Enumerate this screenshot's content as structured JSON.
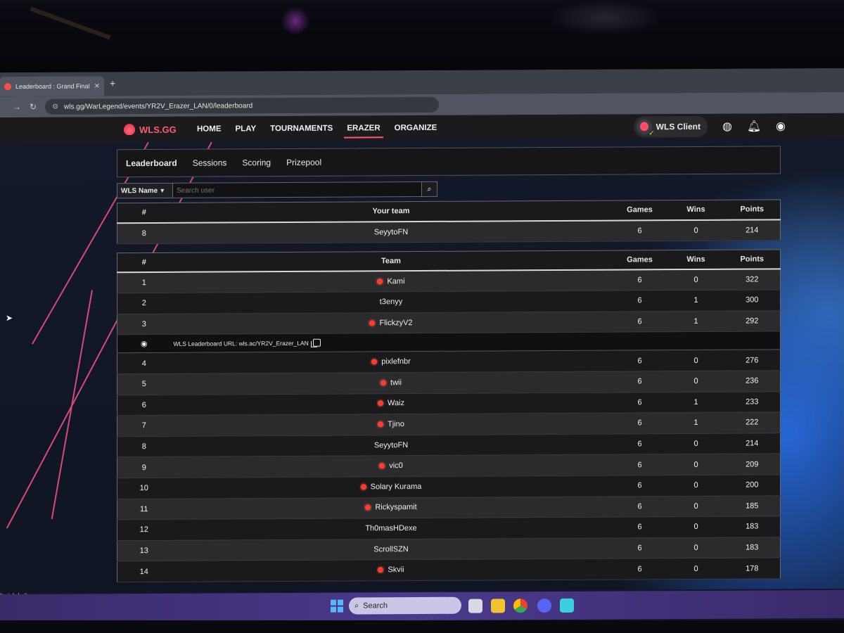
{
  "browser": {
    "tab_title": "Leaderboard : Grand Final | Era:",
    "tab_close": "✕",
    "new_tab": "+",
    "url": "wls.gg/WarLegend/events/YR2V_Erazer_LAN/0/leaderboard"
  },
  "site": {
    "logo": "WLS.GG",
    "nav": [
      "HOME",
      "PLAY",
      "TOURNAMENTS",
      "ERAZER",
      "ORGANIZE"
    ],
    "active_nav": "ERAZER",
    "client_label": "WLS Client"
  },
  "subtabs": [
    "Leaderboard",
    "Sessions",
    "Scoring",
    "Prizepool"
  ],
  "search": {
    "filter": "WLS Name",
    "placeholder": "Search user"
  },
  "your_team": {
    "headers": {
      "rank": "#",
      "team": "Your team",
      "games": "Games",
      "wins": "Wins",
      "points": "Points"
    },
    "row": {
      "rank": "8",
      "team": "SeyytoFN",
      "games": "6",
      "wins": "0",
      "points": "214"
    }
  },
  "leaderboard": {
    "headers": {
      "rank": "#",
      "team": "Team",
      "games": "Games",
      "wins": "Wins",
      "points": "Points"
    },
    "info_text": "WLS Leaderboard URL: wls.ac/YR2V_Erazer_LAN",
    "rows_top": [
      {
        "rank": "1",
        "team": "Kami",
        "live": true,
        "games": "6",
        "wins": "0",
        "points": "322"
      },
      {
        "rank": "2",
        "team": "t3enyy",
        "live": false,
        "games": "6",
        "wins": "1",
        "points": "300"
      },
      {
        "rank": "3",
        "team": "FlickzyV2",
        "live": true,
        "games": "6",
        "wins": "1",
        "points": "292"
      }
    ],
    "rows_rest": [
      {
        "rank": "4",
        "team": "pixlefnbr",
        "live": true,
        "games": "6",
        "wins": "0",
        "points": "276"
      },
      {
        "rank": "5",
        "team": "twii",
        "live": true,
        "games": "6",
        "wins": "0",
        "points": "236"
      },
      {
        "rank": "6",
        "team": "Waiz",
        "live": true,
        "games": "6",
        "wins": "1",
        "points": "233"
      },
      {
        "rank": "7",
        "team": "Tjino",
        "live": true,
        "games": "6",
        "wins": "1",
        "points": "222"
      },
      {
        "rank": "8",
        "team": "SeyytoFN",
        "live": false,
        "games": "6",
        "wins": "0",
        "points": "214"
      },
      {
        "rank": "9",
        "team": "vic0",
        "live": true,
        "games": "6",
        "wins": "0",
        "points": "209"
      },
      {
        "rank": "10",
        "team": "Solary Kurama",
        "live": true,
        "games": "6",
        "wins": "0",
        "points": "200"
      },
      {
        "rank": "11",
        "team": "Rickyspamit",
        "live": true,
        "games": "6",
        "wins": "0",
        "points": "185"
      },
      {
        "rank": "12",
        "team": "Th0masHDexe",
        "live": false,
        "games": "6",
        "wins": "0",
        "points": "183"
      },
      {
        "rank": "13",
        "team": "ScrollSZN",
        "live": false,
        "games": "6",
        "wins": "0",
        "points": "183"
      },
      {
        "rank": "14",
        "team": "Skvii",
        "live": true,
        "games": "6",
        "wins": "0",
        "points": "178"
      }
    ]
  },
  "taskbar": {
    "note_line1": "lt sich kalter...",
    "note_line2": "uell",
    "search_label": "Search"
  },
  "colors": {
    "accent": "#ff5a72",
    "live_dot": "#ff3b2f",
    "taskbar": "#4b3a8c"
  }
}
